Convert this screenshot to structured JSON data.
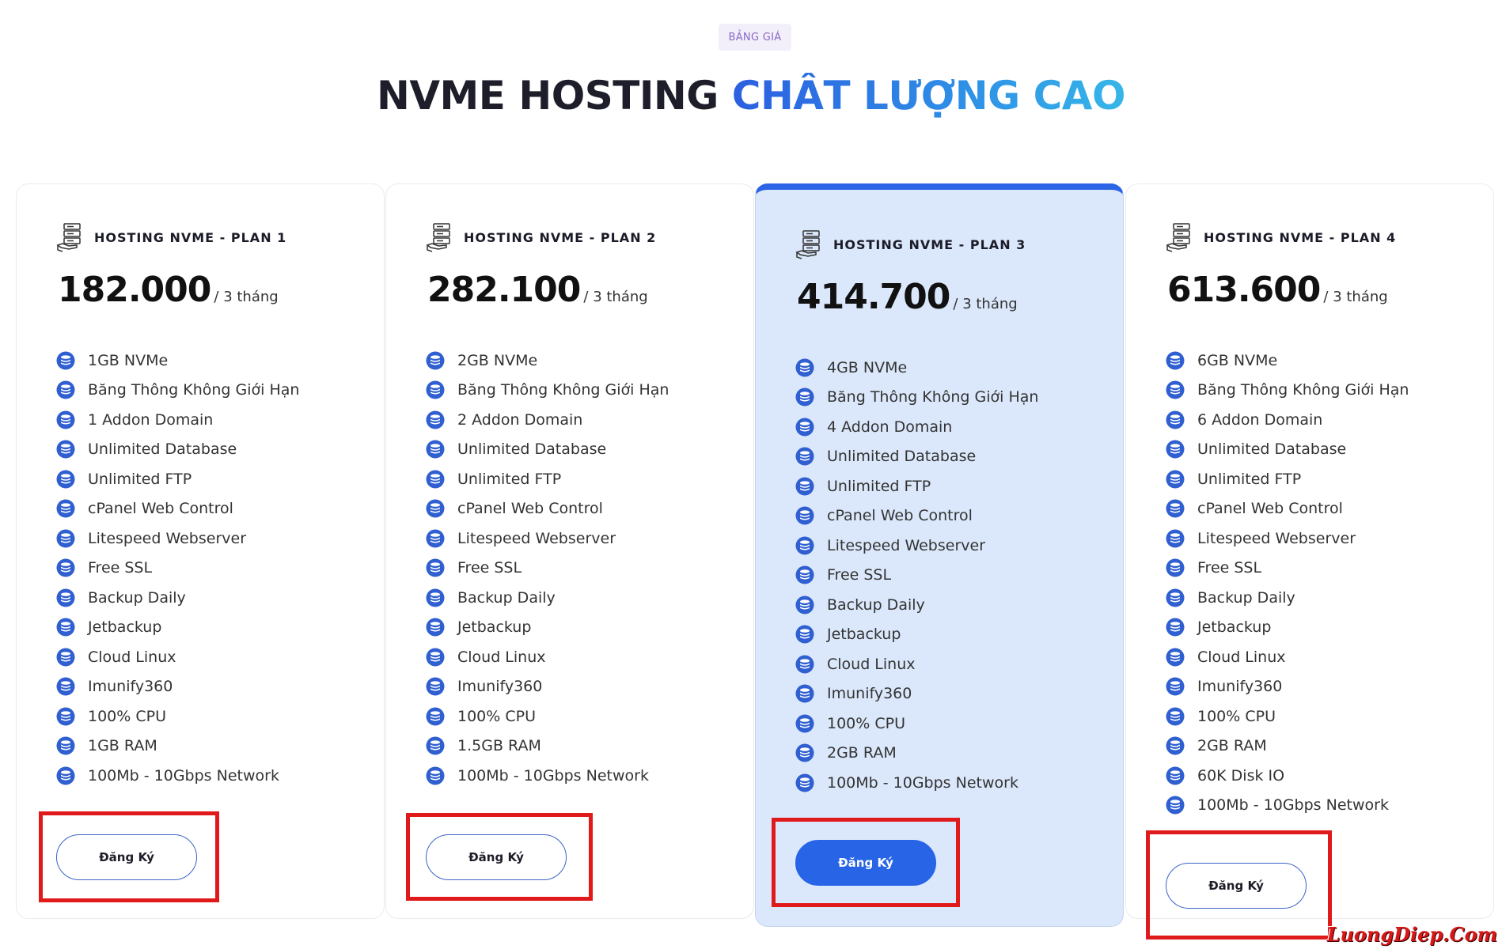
{
  "section": {
    "badge": "BẢNG GIÁ",
    "title_dark": "NVME HOSTING",
    "title_accent": "CHẤT LƯỢNG CAO"
  },
  "colors": {
    "accent": "#2764e6",
    "featured_bg": "#dbe8fb",
    "highlight": "#e01a1a"
  },
  "plans": [
    {
      "name": "HOSTING NVME - PLAN 1",
      "price": "182.000",
      "period": "/ 3 tháng",
      "button": "Đăng Ký",
      "featured": false,
      "features": [
        "1GB NVMe",
        "Băng Thông Không Giới Hạn",
        "1 Addon Domain",
        "Unlimited Database",
        "Unlimited FTP",
        "cPanel Web Control",
        "Litespeed Webserver",
        "Free SSL",
        "Backup Daily",
        "Jetbackup",
        "Cloud Linux",
        "Imunify360",
        "100% CPU",
        "1GB RAM",
        "100Mb - 10Gbps Network"
      ]
    },
    {
      "name": "HOSTING NVME - PLAN 2",
      "price": "282.100",
      "period": "/ 3 tháng",
      "button": "Đăng Ký",
      "featured": false,
      "features": [
        "2GB NVMe",
        "Băng Thông Không Giới Hạn",
        "2 Addon Domain",
        "Unlimited Database",
        "Unlimited FTP",
        "cPanel Web Control",
        "Litespeed Webserver",
        "Free SSL",
        "Backup Daily",
        "Jetbackup",
        "Cloud Linux",
        "Imunify360",
        "100% CPU",
        "1.5GB RAM",
        "100Mb - 10Gbps Network"
      ]
    },
    {
      "name": "HOSTING NVME - PLAN 3",
      "price": "414.700",
      "period": "/ 3 tháng",
      "button": "Đăng Ký",
      "featured": true,
      "features": [
        "4GB NVMe",
        "Băng Thông Không Giới Hạn",
        "4 Addon Domain",
        "Unlimited Database",
        "Unlimited FTP",
        "cPanel Web Control",
        "Litespeed Webserver",
        "Free SSL",
        "Backup Daily",
        "Jetbackup",
        "Cloud Linux",
        "Imunify360",
        "100% CPU",
        "2GB RAM",
        "100Mb - 10Gbps Network"
      ]
    },
    {
      "name": "HOSTING NVME - PLAN 4",
      "price": "613.600",
      "period": "/ 3 tháng",
      "button": "Đăng Ký",
      "featured": false,
      "features": [
        "6GB NVMe",
        "Băng Thông Không Giới Hạn",
        "6 Addon Domain",
        "Unlimited Database",
        "Unlimited FTP",
        "cPanel Web Control",
        "Litespeed Webserver",
        "Free SSL",
        "Backup Daily",
        "Jetbackup",
        "Cloud Linux",
        "Imunify360",
        "100% CPU",
        "2GB RAM",
        "60K Disk IO",
        "100Mb - 10Gbps Network"
      ]
    }
  ],
  "watermark": "LuongDiep.Com"
}
